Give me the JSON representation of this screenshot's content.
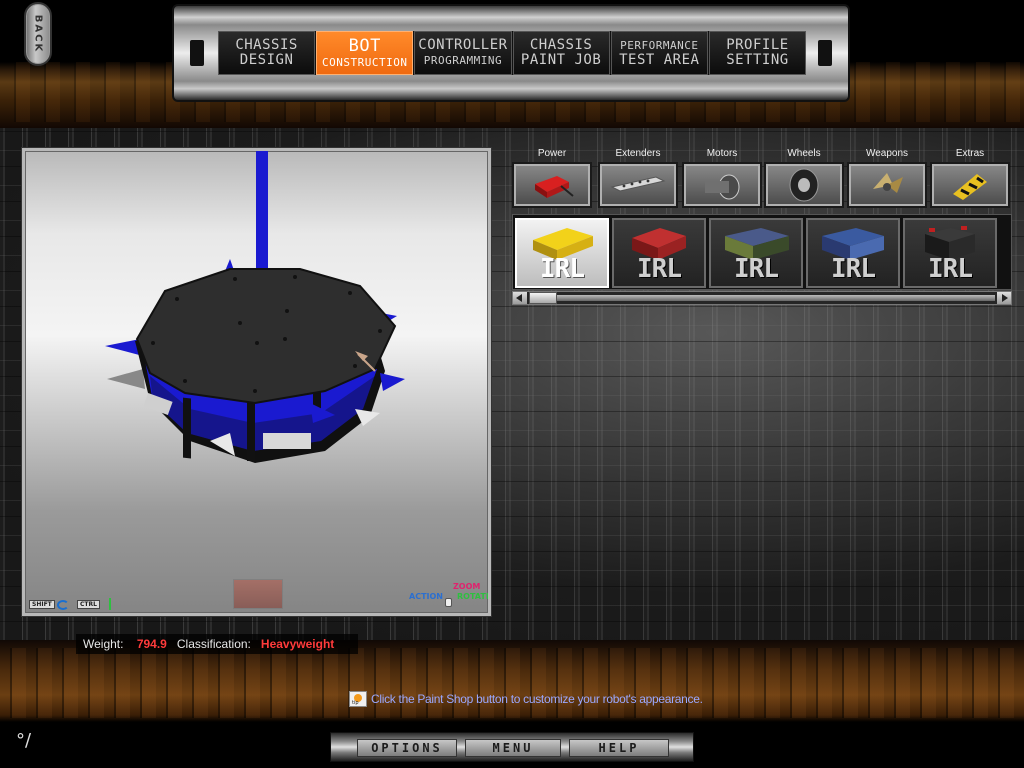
{
  "back_button": {
    "label": "BACK"
  },
  "nav": {
    "tabs": [
      {
        "line1": "CHASSIS",
        "line2": "DESIGN",
        "active": false
      },
      {
        "line1": "BOT",
        "line2": "CONSTRUCTION",
        "active": true
      },
      {
        "line1": "CONTROLLER",
        "line2": "PROGRAMMING",
        "active": false
      },
      {
        "line1": "CHASSIS",
        "line2": "PAINT JOB",
        "active": false
      },
      {
        "line1": "PERFORMANCE",
        "line2": "TEST AREA",
        "active": false
      },
      {
        "line1": "PROFILE",
        "line2": "SETTING",
        "active": false
      }
    ]
  },
  "viewport": {
    "hints": {
      "shift": "SHIFT",
      "ctrl": "CTRL",
      "action": "ACTION",
      "zoom": "ZOOM",
      "rotate": "ROTATE"
    }
  },
  "categories": [
    {
      "label": "Power",
      "icon": "battery-icon"
    },
    {
      "label": "Extenders",
      "icon": "extender-bar-icon"
    },
    {
      "label": "Motors",
      "icon": "motor-icon"
    },
    {
      "label": "Wheels",
      "icon": "wheel-icon"
    },
    {
      "label": "Weapons",
      "icon": "weapon-icon"
    },
    {
      "label": "Extras",
      "icon": "extras-icon"
    }
  ],
  "parts": [
    {
      "label": "IRL",
      "color": "#e0c020",
      "selected": true
    },
    {
      "label": "IRL",
      "color": "#b02a2a",
      "selected": false
    },
    {
      "label": "IRL",
      "color": "#5a6a3a",
      "selected": false
    },
    {
      "label": "IRL",
      "color": "#3a5aa0",
      "selected": false
    },
    {
      "label": "IRL",
      "color": "#2a2a2a",
      "selected": false
    }
  ],
  "status": {
    "weight_label": "Weight:",
    "weight_value": "794.9",
    "class_label": "Classification:",
    "class_value": "Heavyweight"
  },
  "tip": {
    "icon_text": "tip",
    "text": "Click the Paint Shop button to customize your robot's appearance."
  },
  "bottom_buttons": {
    "options": "OPTIONS",
    "menu": "MENU",
    "help": "HELP"
  },
  "colors": {
    "accent": "#f26f16",
    "value_red": "#ff3b3b",
    "tip_blue": "#9aa8ff",
    "robot_blue": "#1a1ad0"
  }
}
